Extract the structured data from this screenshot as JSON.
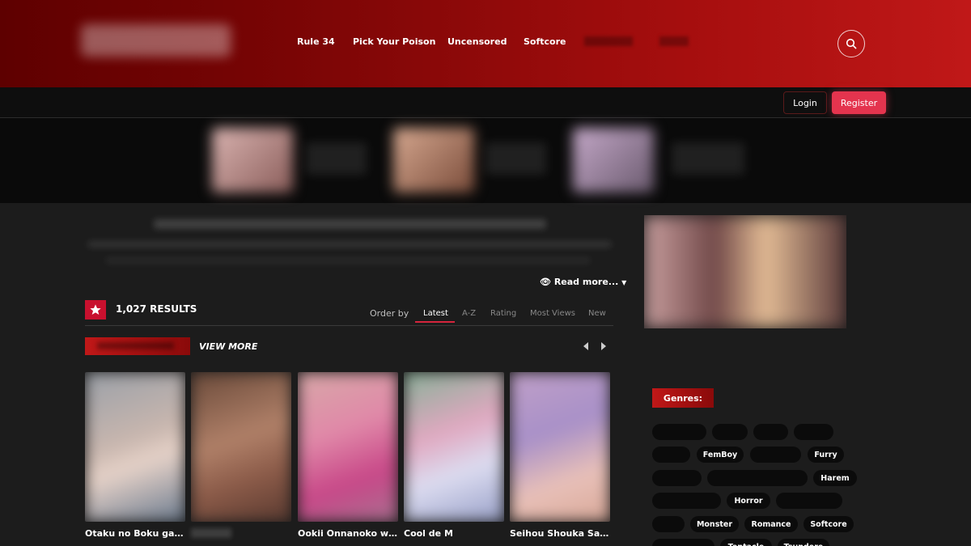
{
  "header": {
    "nav": [
      {
        "label": "Rule 34"
      },
      {
        "label": "Pick Your Poison"
      },
      {
        "label": "Uncensored"
      },
      {
        "label": "Softcore"
      },
      {
        "label": ""
      },
      {
        "label": ""
      }
    ]
  },
  "auth": {
    "login": "Login",
    "register": "Register"
  },
  "main": {
    "read_more": "Read more...",
    "results_count": "1,027 RESULTS",
    "order_label": "Order by",
    "order_tabs": [
      "Latest",
      "A-Z",
      "Rating",
      "Most Views",
      "New"
    ],
    "active_tab": "Latest",
    "view_more": "VIEW MORE",
    "cards": [
      {
        "title": "Otaku no Boku ga Ic..."
      },
      {
        "title": ""
      },
      {
        "title": "Ookii Onnanoko wa ..."
      },
      {
        "title": "Cool de M"
      },
      {
        "title": "Seihou Shouka Sain..."
      }
    ]
  },
  "sidebar": {
    "genres_label": "Genres:",
    "genres": [
      "",
      "",
      "",
      "",
      "",
      "FemBoy",
      "",
      "Furry",
      "",
      "",
      "Harem",
      "",
      "Horror",
      "",
      "",
      "Monster",
      "Romance",
      "Softcore",
      "",
      "Tentacle",
      "Tsundere"
    ]
  },
  "colors": {
    "accent": "#e4344e",
    "header_dark": "#5e0000",
    "header_light": "#c01818"
  }
}
